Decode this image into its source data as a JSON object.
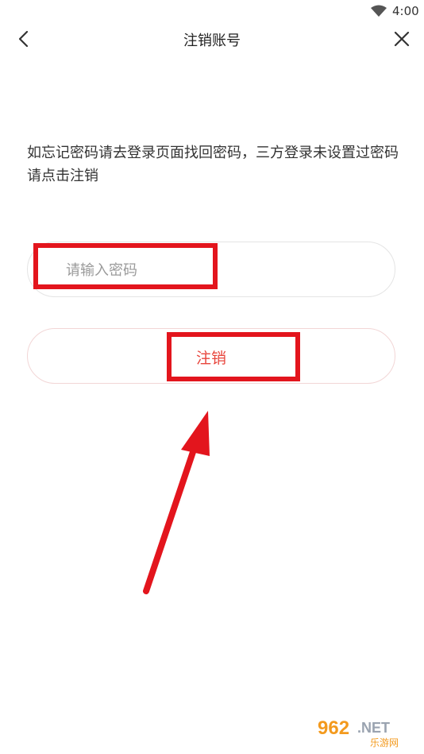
{
  "status_bar": {
    "time": "4:00",
    "wifi_icon": "wifi-icon"
  },
  "nav": {
    "title": "注销账号",
    "back_icon": "chevron-left-icon",
    "close_icon": "close-icon"
  },
  "hint_text": "如忘记密码请去登录页面找回密码，三方登录未设置过密码请点击注销",
  "password": {
    "placeholder": "请输入密码",
    "value": ""
  },
  "cancel_button_label": "注销",
  "colors": {
    "accent": "#e8453c",
    "annotation_red": "#e3151d",
    "border": "#e4e4e4"
  },
  "watermark": {
    "brand": "962.NET",
    "sub": "乐游网"
  }
}
